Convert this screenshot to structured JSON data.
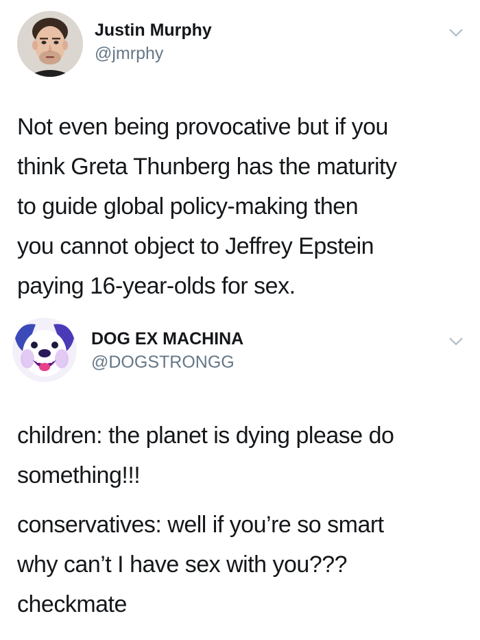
{
  "tweets": [
    {
      "display_name": "Justin Murphy",
      "handle": "@jmrphy",
      "avatar": "person-portrait-avatar",
      "menu_icon": "chevron-down-icon",
      "text_lines": [
        "Not even being provocative but if you",
        "think Greta Thunberg has the maturity",
        "to guide global policy-making then",
        "you cannot object to Jeffrey Epstein",
        "paying 16-year-olds for sex."
      ]
    },
    {
      "display_name": "DOG EX MACHINA",
      "handle": "@DOGSTRONGG",
      "avatar": "dog-face-avatar",
      "menu_icon": "chevron-down-icon",
      "paragraph1_lines": [
        "children: the planet is dying please do",
        "something!!!"
      ],
      "paragraph2_lines": [
        "conservatives: well if you’re so smart",
        "why can’t I have sex with you???",
        "checkmate"
      ]
    }
  ],
  "colors": {
    "text": "#14171a",
    "secondary": "#657786",
    "chevron": "#aab8c2",
    "background": "#ffffff"
  }
}
